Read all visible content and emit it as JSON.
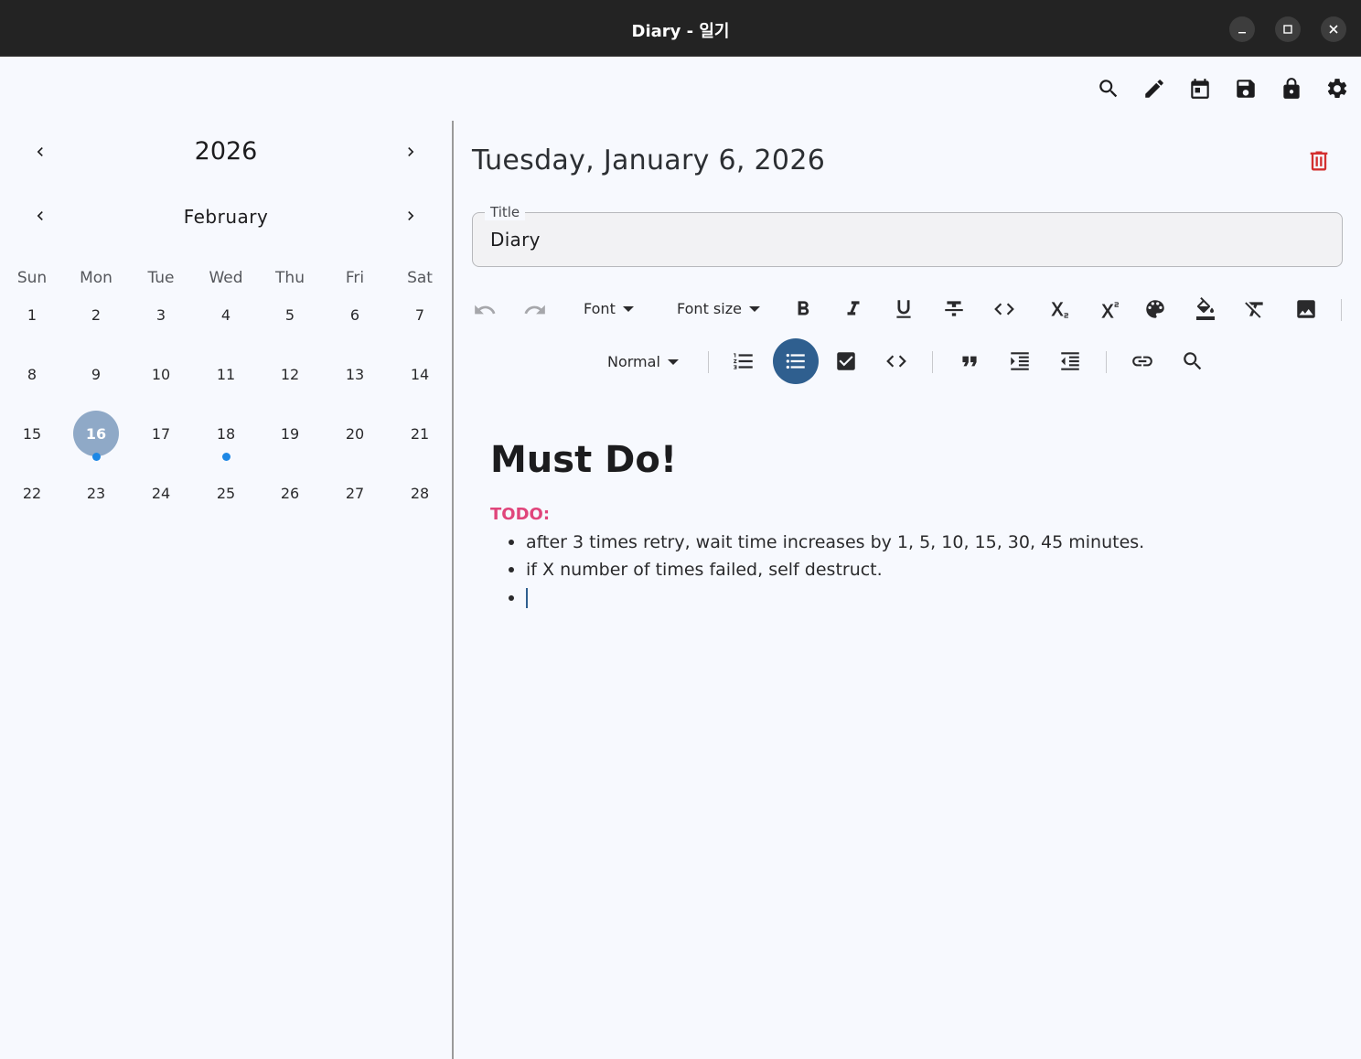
{
  "window": {
    "title": "Diary - 일기"
  },
  "app_toolbar": {
    "icons": [
      "search-icon",
      "edit-icon",
      "calendar-icon",
      "save-icon",
      "lock-icon",
      "settings-icon"
    ]
  },
  "calendar": {
    "year": "2026",
    "month": "February",
    "weekdays": [
      "Sun",
      "Mon",
      "Tue",
      "Wed",
      "Thu",
      "Fri",
      "Sat"
    ],
    "weeks": [
      [
        "1",
        "2",
        "3",
        "4",
        "5",
        "6",
        "7"
      ],
      [
        "8",
        "9",
        "10",
        "11",
        "12",
        "13",
        "14"
      ],
      [
        "15",
        "16",
        "17",
        "18",
        "19",
        "20",
        "21"
      ],
      [
        "22",
        "23",
        "24",
        "25",
        "26",
        "27",
        "28"
      ]
    ],
    "selected_day": "16",
    "days_with_entries": [
      "16",
      "18"
    ],
    "accent_color": "#8fa9c7",
    "dot_color": "#1e88e5"
  },
  "entry": {
    "date_heading": "Tuesday, January 6, 2026",
    "title_label": "Title",
    "title_value": "Diary",
    "delete_color": "#d32f2f"
  },
  "editor_toolbar": {
    "font_label": "Font",
    "font_size_label": "Font size",
    "block_type_label": "Normal",
    "active_color": "#2f5f8f"
  },
  "document": {
    "heading": "Must Do!",
    "todo_label": "TODO:",
    "todo_color": "#e0457b",
    "bullets": [
      "after 3 times retry, wait time increases by 1, 5, 10, 15, 30, 45 minutes.",
      "if X number of times failed, self destruct.",
      ""
    ]
  }
}
